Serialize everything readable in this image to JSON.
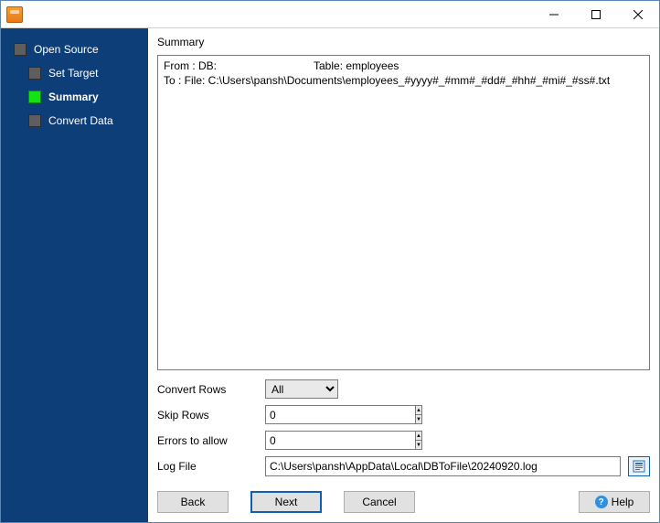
{
  "titlebar": {
    "title": ""
  },
  "sidebar": {
    "items": [
      {
        "label": "Open Source"
      },
      {
        "label": "Set Target"
      },
      {
        "label": "Summary"
      },
      {
        "label": "Convert Data"
      }
    ]
  },
  "main": {
    "group_label": "Summary",
    "summary": {
      "from_prefix": "From : DB:",
      "from_table": "Table: employees",
      "to_line": "To : File: C:\\Users\\pansh\\Documents\\employees_#yyyy#_#mm#_#dd#_#hh#_#mi#_#ss#.txt"
    },
    "fields": {
      "convert_rows": {
        "label": "Convert Rows",
        "value": "All"
      },
      "skip_rows": {
        "label": "Skip Rows",
        "value": "0"
      },
      "errors_to_allow": {
        "label": "Errors to allow",
        "value": "0"
      },
      "log_file": {
        "label": "Log File",
        "value": "C:\\Users\\pansh\\AppData\\Local\\DBToFile\\20240920.log"
      }
    }
  },
  "footer": {
    "back": "Back",
    "next": "Next",
    "cancel": "Cancel",
    "help": "Help"
  }
}
